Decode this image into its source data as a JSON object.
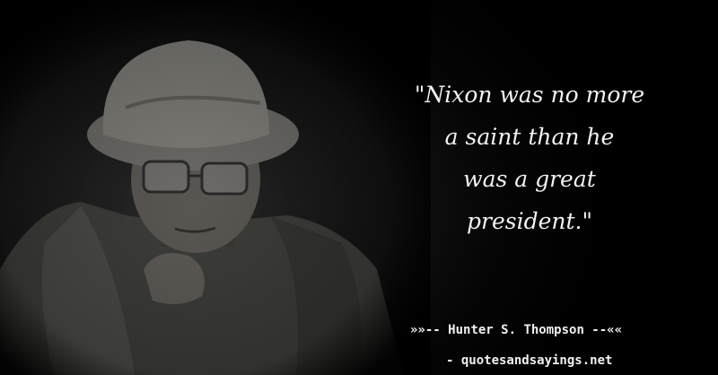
{
  "quote": {
    "lines": [
      "\"Nixon was no more",
      "a saint than he",
      "was a great",
      "president.\""
    ]
  },
  "author": {
    "prefix": "»»-- ",
    "name": "Hunter S. Thompson",
    "suffix": " --««"
  },
  "site": {
    "label": "- quotesandsayings.net"
  },
  "colors": {
    "background": "#000000",
    "text": "#f2f2f2"
  }
}
